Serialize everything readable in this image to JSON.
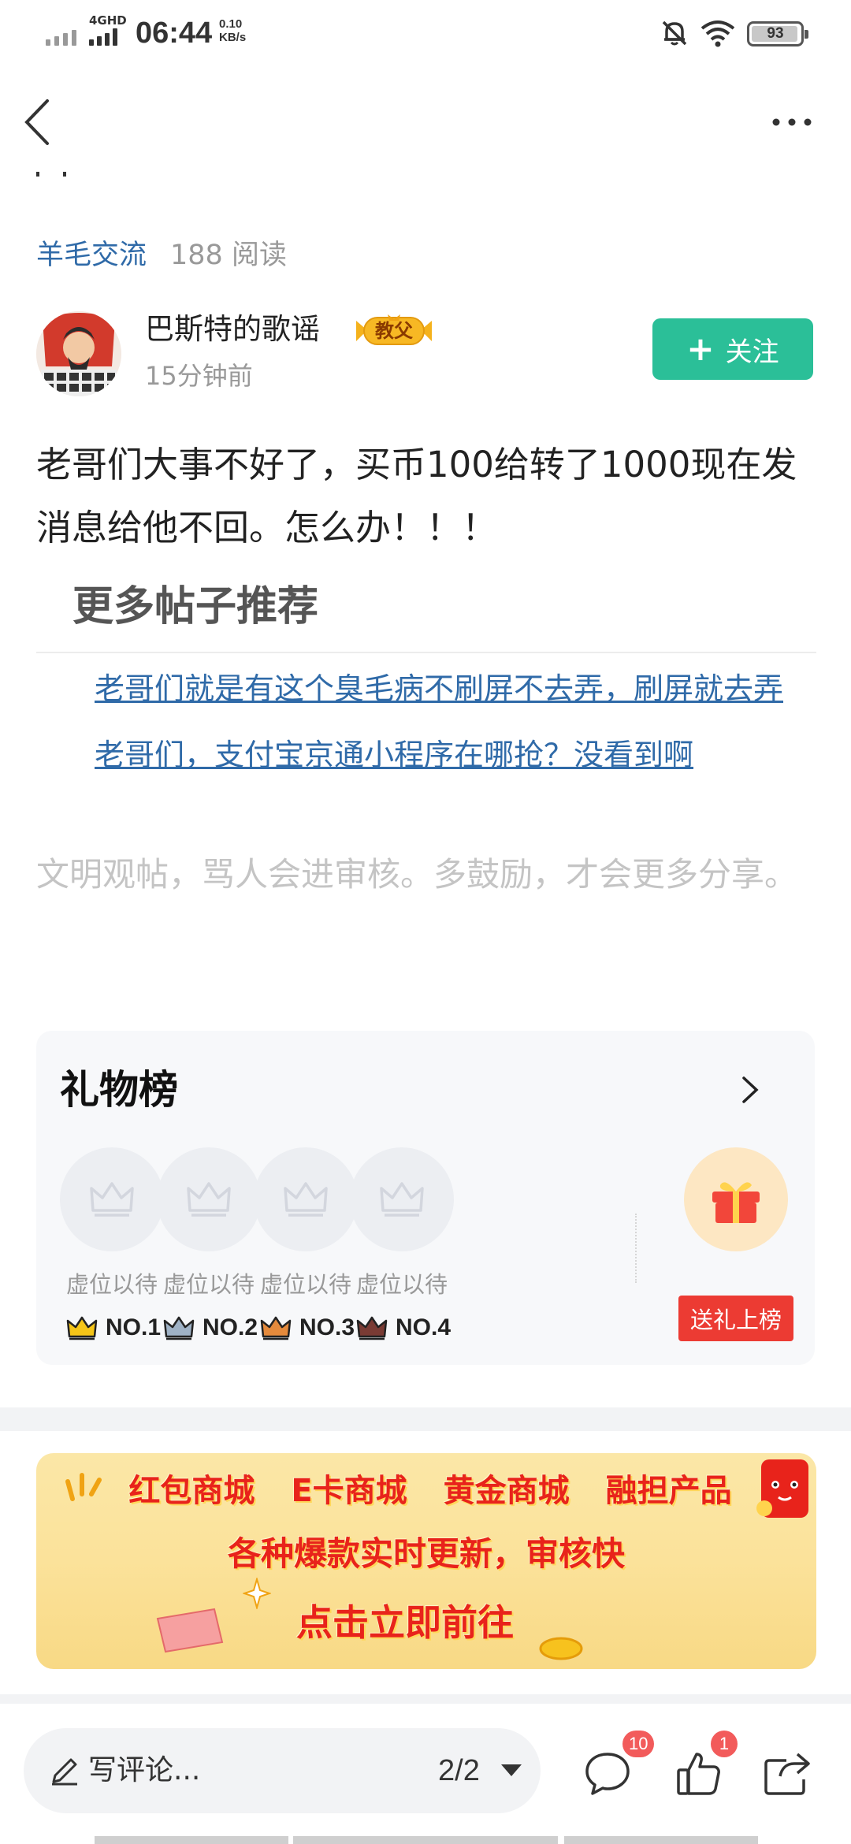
{
  "status_bar": {
    "network": "4GHD",
    "time": "06:44",
    "speed_value": "0.10",
    "speed_unit": "KB/s",
    "battery": "93"
  },
  "post": {
    "category": "羊毛交流",
    "read_count": "188 阅读",
    "author": "巴斯特的歌谣",
    "badge": "教父",
    "time": "15分钟前",
    "follow_label": "关注",
    "body": "老哥们大事不好了，买币100给转了1000现在发消息给他不回。怎么办！！！"
  },
  "recommend": {
    "title": "更多帖子推荐",
    "items": [
      "老哥们就是有这个臭毛病不刷屏不去弄，刷屏就去弄",
      "老哥们，支付宝京通小程序在哪抢？没看到啊"
    ]
  },
  "civil_note": "文明观帖，骂人会进审核。多鼓励，才会更多分享。",
  "gift_board": {
    "title": "礼物榜",
    "slots": [
      {
        "label": "虚位以待",
        "rank": "NO.1",
        "crown_color": "#f5c518"
      },
      {
        "label": "虚位以待",
        "rank": "NO.2",
        "crown_color": "#9fb2c6"
      },
      {
        "label": "虚位以待",
        "rank": "NO.3",
        "crown_color": "#e58a3c"
      },
      {
        "label": "虚位以待",
        "rank": "NO.4",
        "crown_color": "#7a3b34"
      }
    ],
    "send_label": "送礼上榜"
  },
  "banner": {
    "items": [
      "红包商城",
      "E卡商城",
      "黄金商城",
      "融担产品"
    ],
    "subtitle": "各种爆款实时更新，审核快",
    "cta": "点击立即前往"
  },
  "bottom_bar": {
    "comment_placeholder": "写评论...",
    "page": "2/2",
    "comment_count": "10",
    "like_count": "1"
  },
  "colors": {
    "accent_green": "#2bbf98",
    "link_blue": "#2f6aa8",
    "red": "#ec3b33"
  }
}
